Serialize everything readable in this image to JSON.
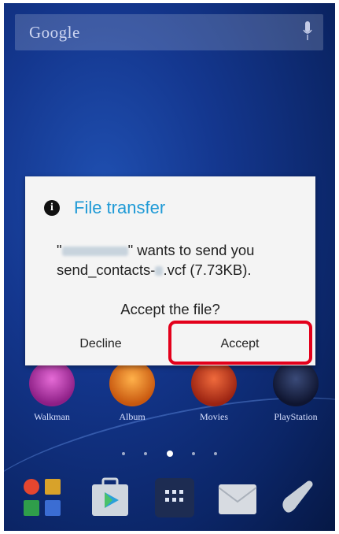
{
  "search": {
    "label": "Google"
  },
  "dialog": {
    "title": "File transfer",
    "message_prefix": "\"",
    "message_mid": "\" wants to send you",
    "file_prefix": "send_contacts-",
    "file_suffix": ".vcf (7.73KB).",
    "question": "Accept the file?",
    "decline_label": "Decline",
    "accept_label": "Accept"
  },
  "apps": [
    {
      "label": "Walkman",
      "icon": "walkman-icon",
      "color": "#b83aa8"
    },
    {
      "label": "Album",
      "icon": "album-icon",
      "color": "#e87a1e"
    },
    {
      "label": "Movies",
      "icon": "movies-icon",
      "color": "#c8371f"
    },
    {
      "label": "PlayStation",
      "icon": "playstation-icon",
      "color": "#1a2540"
    }
  ],
  "dock": [
    {
      "icon": "google-apps-folder-icon"
    },
    {
      "icon": "play-store-icon"
    },
    {
      "icon": "app-drawer-icon"
    },
    {
      "icon": "email-icon"
    },
    {
      "icon": "phone-icon"
    }
  ],
  "colors": {
    "accent": "#1f9ad6",
    "highlight": "#e3001b"
  }
}
